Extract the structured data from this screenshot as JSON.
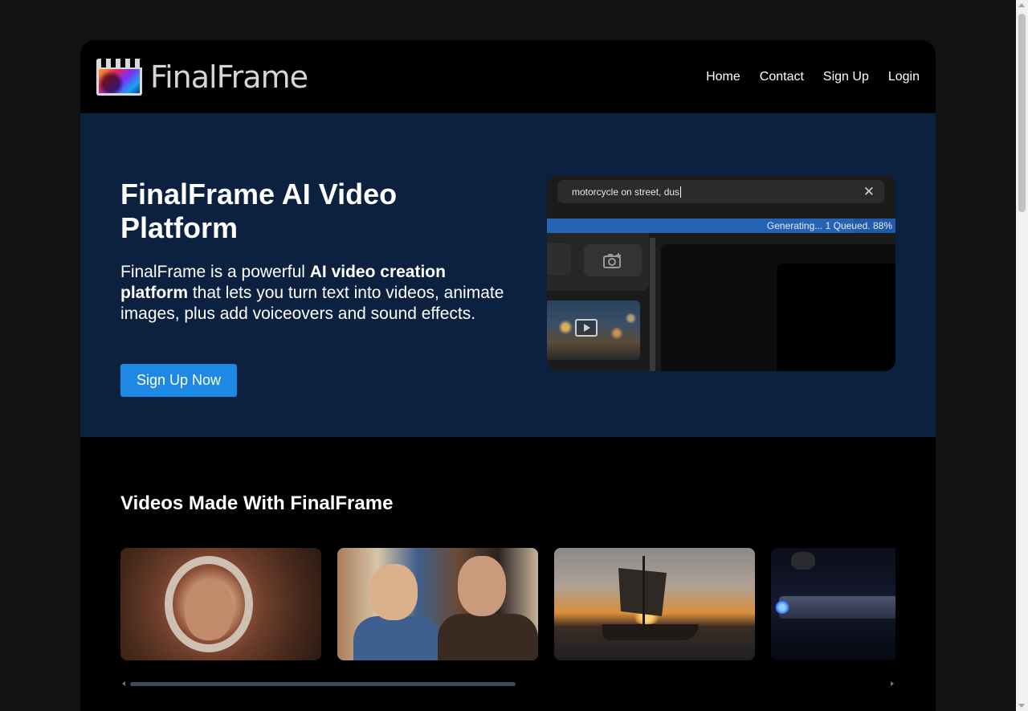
{
  "brand": {
    "name": "FinalFrame",
    "logo_icon": "clapperboard-logo-icon"
  },
  "nav": {
    "items": [
      {
        "label": "Home"
      },
      {
        "label": "Contact"
      },
      {
        "label": "Sign Up"
      },
      {
        "label": "Login"
      }
    ]
  },
  "hero": {
    "title": "FinalFrame AI Video Platform",
    "lead_pre": "FinalFrame is a powerful ",
    "lead_bold": "AI video creation platform",
    "lead_post": " that lets you turn text into videos, animate images, plus add voiceovers and sound effects.",
    "cta_label": "Sign Up Now",
    "background_color": "#0c2040",
    "cta_color": "#1e88e5"
  },
  "preview": {
    "prompt_text": "motorcycle on street, dus",
    "status_text": "Generating... 1 Queued. 88%",
    "progress_fraction": 0.88,
    "icons": [
      "close-icon",
      "camera-add-icon",
      "video-play-icon"
    ]
  },
  "gallery": {
    "title": "Videos Made With FinalFrame",
    "items": [
      {
        "subject": "astronaut-woman"
      },
      {
        "subject": "two-men-diner"
      },
      {
        "subject": "sailing-ship-sunset"
      },
      {
        "subject": "spaceship-planet"
      }
    ]
  },
  "colors": {
    "page_background": "#121212",
    "site_background": "#000000",
    "accent": "#1e88e5",
    "status_bar": "#1f5aa8"
  }
}
